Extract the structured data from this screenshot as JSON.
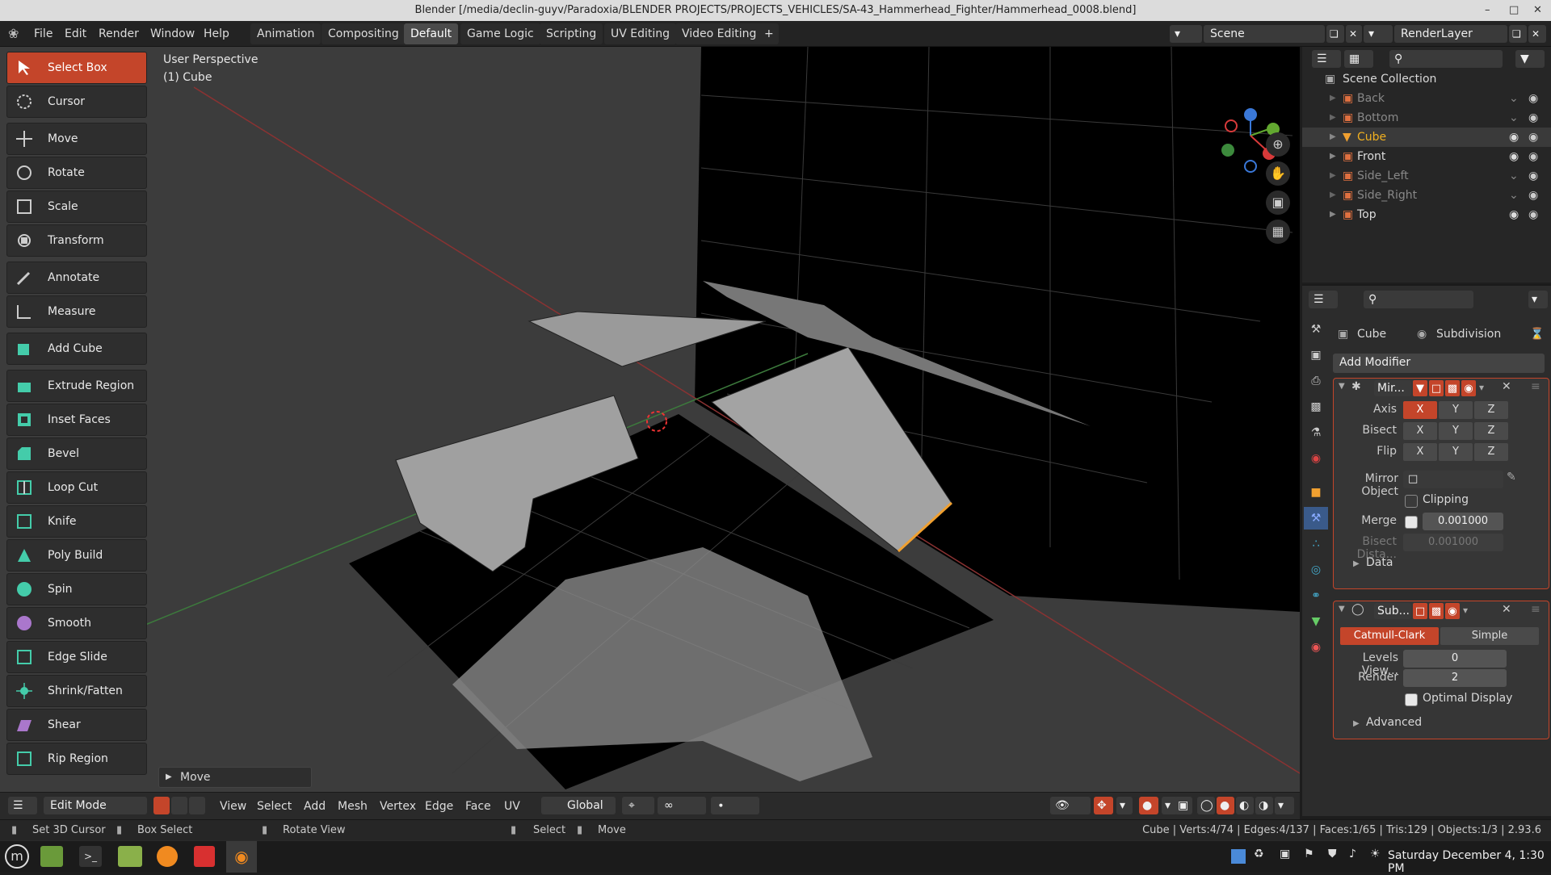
{
  "window": {
    "title": "Blender [/media/declin-guyv/Paradoxia/BLENDER PROJECTS/PROJECTS_VEHICLES/SA-43_Hammerhead_Fighter/Hammerhead_0008.blend]"
  },
  "menus": [
    "File",
    "Edit",
    "Render",
    "Window",
    "Help"
  ],
  "workspaces": [
    "Animation",
    "Compositing",
    "Default",
    "Game Logic",
    "Scripting",
    "UV Editing",
    "Video Editing"
  ],
  "active_workspace": "Default",
  "scene": {
    "label": "Scene",
    "render_layer": "RenderLayer"
  },
  "tools": [
    "Select Box",
    "Cursor",
    "Move",
    "Rotate",
    "Scale",
    "Transform",
    "Annotate",
    "Measure",
    "Add Cube",
    "Extrude Region",
    "Inset Faces",
    "Bevel",
    "Loop Cut",
    "Knife",
    "Poly Build",
    "Spin",
    "Smooth",
    "Edge Slide",
    "Shrink/Fatten",
    "Shear",
    "Rip Region"
  ],
  "viewport": {
    "perspective": "User Perspective",
    "object": "(1) Cube",
    "last_op": "Move"
  },
  "editor_header": {
    "mode": "Edit Mode",
    "menus": [
      "View",
      "Select",
      "Add",
      "Mesh",
      "Vertex",
      "Edge",
      "Face",
      "UV"
    ],
    "orientation": "Global"
  },
  "outliner": {
    "collection": "Scene Collection",
    "items": [
      {
        "name": "Back",
        "visible": false
      },
      {
        "name": "Bottom",
        "visible": false
      },
      {
        "name": "Cube",
        "visible": true,
        "active": true
      },
      {
        "name": "Front",
        "visible": true
      },
      {
        "name": "Side_Left",
        "visible": false
      },
      {
        "name": "Side_Right",
        "visible": false
      },
      {
        "name": "Top",
        "visible": true
      }
    ]
  },
  "properties": {
    "object": "Cube",
    "modifier_tab": "Subdivision",
    "add_modifier": "Add Modifier",
    "mirror": {
      "name": "Mir...",
      "axis_label": "Axis",
      "bisect_label": "Bisect",
      "flip_label": "Flip",
      "axes": [
        "X",
        "Y",
        "Z"
      ],
      "mirror_object_label": "Mirror Object",
      "clipping": "Clipping",
      "merge_label": "Merge",
      "merge_value": "0.001000",
      "bisect_dist_label": "Bisect Dista...",
      "bisect_dist_value": "0.001000",
      "data": "Data"
    },
    "subsurf": {
      "name": "Sub...",
      "catmull": "Catmull-Clark",
      "simple": "Simple",
      "levels_label": "Levels View...",
      "levels_value": "0",
      "render_label": "Render",
      "render_value": "2",
      "optimal": "Optimal Display",
      "advanced": "Advanced"
    }
  },
  "statusbar": {
    "hint1": "Set 3D Cursor",
    "hint2": "Box Select",
    "hint3": "Rotate View",
    "hint4": "Select",
    "hint5": "Move",
    "stats": "Cube | Verts:4/74 | Edges:4/137 | Faces:1/65 | Tris:129 | Objects:1/3 | 2.93.6"
  },
  "taskbar": {
    "clock": "Saturday December  4, 1:30 PM"
  },
  "colors": {
    "accent": "#c4452a",
    "viewport_bg": "#3c3c3c",
    "selected_text": "#f0b020"
  }
}
